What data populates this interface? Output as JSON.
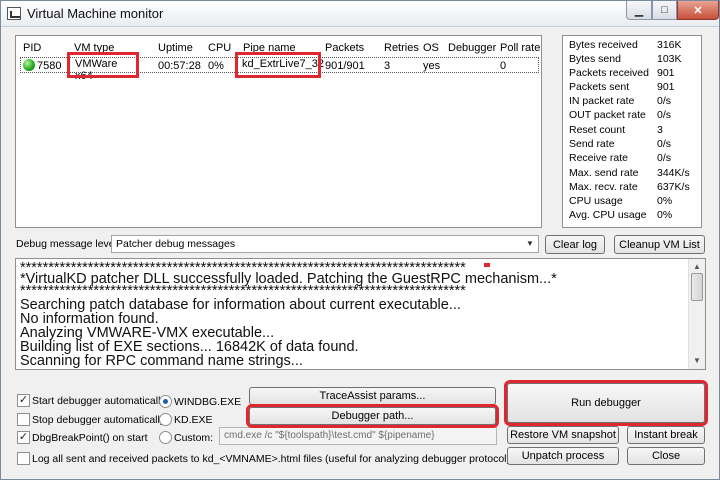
{
  "window": {
    "title": "Virtual Machine monitor",
    "minimize_label": "▁",
    "maximize_label": "□",
    "close_label": "✕"
  },
  "vm_list": {
    "columns": [
      "PID",
      "VM type",
      "Uptime",
      "CPU",
      "Pipe name",
      "Packets",
      "Retries",
      "OS",
      "Debugger",
      "Poll rate"
    ],
    "rows": [
      {
        "status_icon": "green-circle-icon",
        "pid": "7580",
        "vm_type": "VMWare x64",
        "uptime": "00:57:28",
        "cpu": "0%",
        "pipe_name": "kd_ExtrLive7_32",
        "packets": "901/901",
        "retries": "3",
        "os": "yes",
        "debugger": "",
        "poll_rate": "0"
      }
    ]
  },
  "stats": [
    {
      "label": "Bytes received",
      "value": "316K"
    },
    {
      "label": "Bytes send",
      "value": "103K"
    },
    {
      "label": "Packets received",
      "value": "901"
    },
    {
      "label": "Packets sent",
      "value": "901"
    },
    {
      "label": "IN packet rate",
      "value": "0/s"
    },
    {
      "label": "OUT packet rate",
      "value": "0/s"
    },
    {
      "label": "Reset count",
      "value": "3"
    },
    {
      "label": "Send rate",
      "value": "0/s"
    },
    {
      "label": "Receive rate",
      "value": "0/s"
    },
    {
      "label": "Max. send rate",
      "value": "344K/s"
    },
    {
      "label": "Max. recv. rate",
      "value": "637K/s"
    },
    {
      "label": "CPU usage",
      "value": "0%"
    },
    {
      "label": "Avg. CPU usage",
      "value": "0%"
    }
  ],
  "debug_level": {
    "label": "Debug message level:",
    "selected": "Patcher debug messages"
  },
  "buttons": {
    "clear_log": "Clear log",
    "cleanup_vm_list": "Cleanup VM List",
    "traceassist_params": "TraceAssist params...",
    "debugger_path": "Debugger path...",
    "run_debugger": "Run debugger",
    "restore_vm_snapshot": "Restore VM snapshot",
    "instant_break": "Instant break",
    "unpatch_process": "Unpatch process",
    "close": "Close"
  },
  "log": {
    "lines": [
      "*******************************************************************************",
      "*VirtualKD patcher DLL successfully loaded. Patching the GuestRPC mechanism...*",
      "*******************************************************************************",
      "Searching patch database for information about current executable...",
      "No information found.",
      "Analyzing VMWARE-VMX executable...",
      "Building list of EXE sections... 16842K of data found.",
      "Scanning for RPC command name strings..."
    ]
  },
  "options": {
    "start_debugger_automatically": {
      "label": "Start debugger automatically",
      "checked": true
    },
    "stop_debugger_automatically": {
      "label": "Stop debugger automatically",
      "checked": false
    },
    "dbg_breakpoint_on_start": {
      "label": "DbgBreakPoint() on start",
      "checked": true
    },
    "log_all_packets": {
      "label": "Log all sent and received packets to kd_<VMNAME>.html files (useful for analyzing debugger protocol)",
      "checked": false
    }
  },
  "debugger_choice": {
    "options": [
      "WINDBG.EXE",
      "KD.EXE",
      "Custom:"
    ],
    "selected": "WINDBG.EXE",
    "custom_command": "cmd.exe /c \"${toolspath}\\test.cmd\" ${pipename}"
  },
  "colors": {
    "highlight_red": "#e0262e",
    "window_bg": "#f0f0f0",
    "status_green": "#1ea51e"
  }
}
